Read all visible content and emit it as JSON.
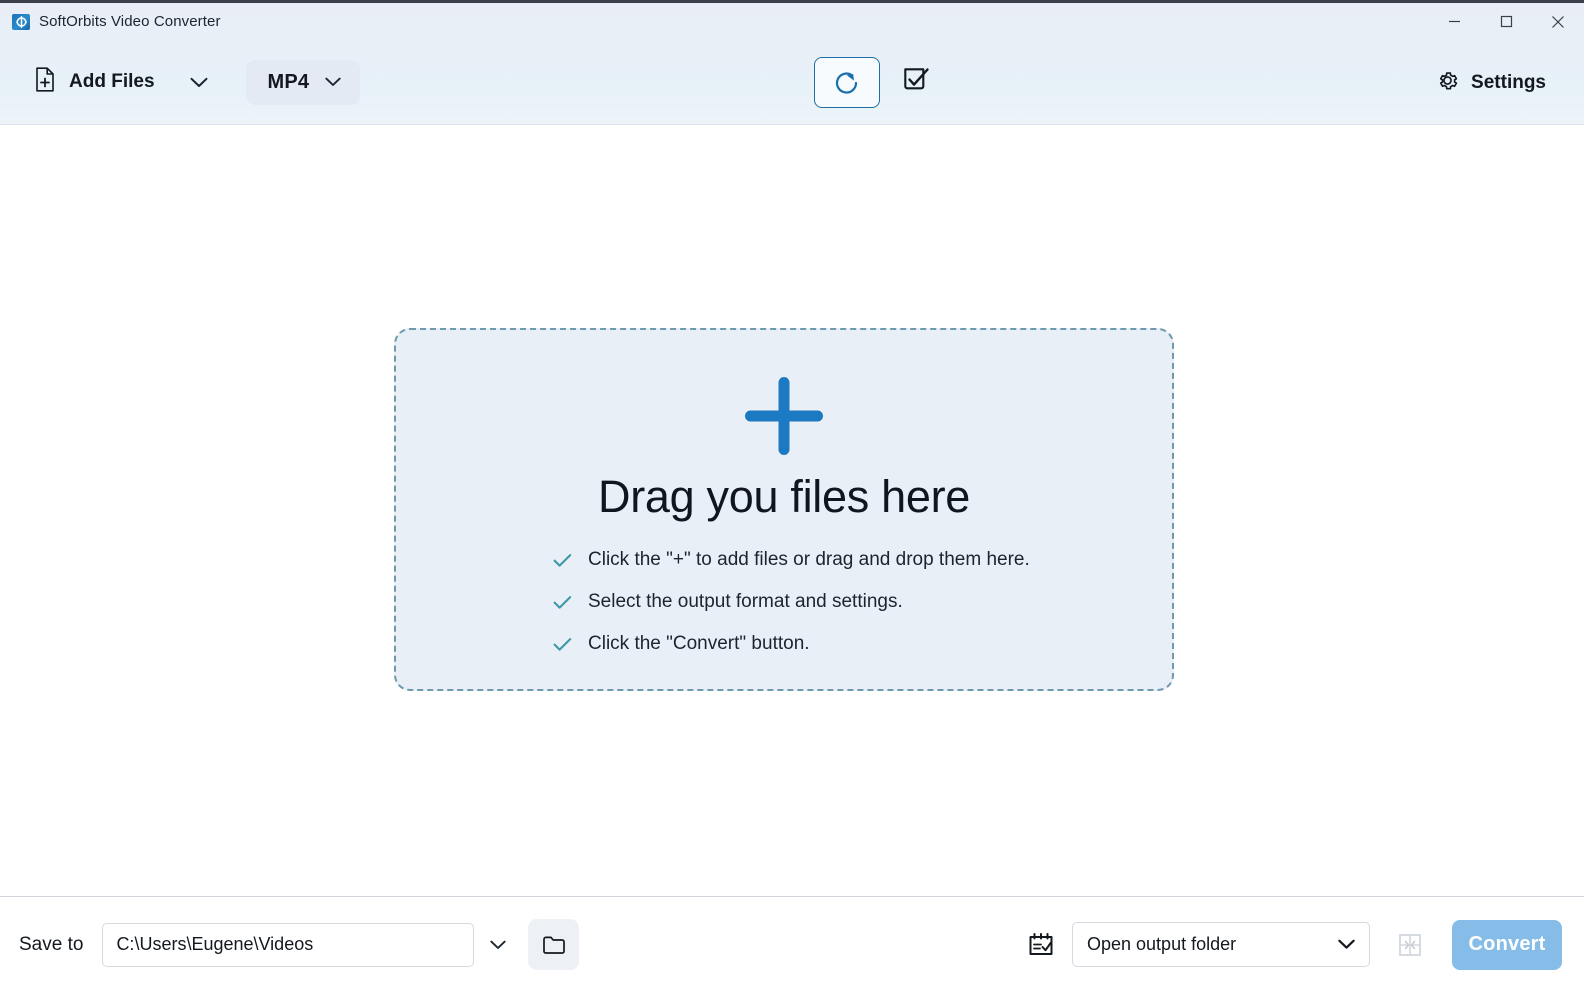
{
  "window": {
    "title": "SoftOrbits Video Converter",
    "app_icon": "app-logo-icon",
    "controls": {
      "minimize": "minimize-icon",
      "maximize": "maximize-icon",
      "close": "close-icon"
    }
  },
  "toolbar": {
    "add_files_label": "Add Files",
    "add_files_icon": "file-add-icon",
    "add_files_caret_icon": "chevron-down-icon",
    "format_label": "MP4",
    "format_caret_icon": "chevron-down-icon",
    "rotate_icon": "rotate-clockwise-icon",
    "checkbox_icon": "checkbox-checked-icon",
    "settings_label": "Settings",
    "settings_icon": "gear-icon"
  },
  "dropzone": {
    "plus_icon": "plus-icon",
    "title": "Drag you files here",
    "tips": [
      "Click the \"+\" to add files or drag and drop them here.",
      "Select the output format and settings.",
      "Click the \"Convert\" button."
    ],
    "tip_icon": "check-icon"
  },
  "bottombar": {
    "save_to_label": "Save to",
    "path_value": "C:\\Users\\Eugene\\Videos",
    "path_placeholder": "C:\\Users\\Eugene\\Videos",
    "path_caret_icon": "chevron-down-icon",
    "folder_icon": "folder-icon",
    "calendar_icon": "calendar-check-icon",
    "output_action": "Open output folder",
    "output_caret_icon": "chevron-down-icon",
    "merge_icon": "merge-files-icon",
    "convert_label": "Convert"
  },
  "colors": {
    "accent_blue": "#1b7ac2",
    "titlebar_bg": "#e9eef6",
    "toolbar_bg": "#e8f0f7",
    "dropzone_bg": "#e9eff7",
    "dropzone_border": "#6f9aad",
    "tick_teal": "#3f98a8",
    "convert_disabled": "#86bde8"
  }
}
